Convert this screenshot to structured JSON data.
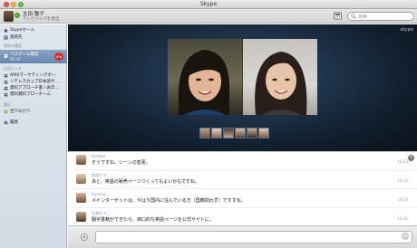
{
  "window": {
    "title": "Skype"
  },
  "profile": {
    "name": "太田 敬子",
    "mood": "テレビジャパを見出"
  },
  "search": {
    "placeholder": "検索"
  },
  "sidebar": {
    "items": [
      {
        "label": "Skypeホーム",
        "icon": "home-icon"
      },
      {
        "label": "連絡先",
        "icon": "contacts-icon"
      }
    ],
    "recent_heading": "現在の通話",
    "active_call": {
      "label": "リスチーム電話",
      "duration": "00:44"
    },
    "favorites_heading": "お気に入り",
    "favorites": [
      {
        "label": "AIRSマーケティングボー"
      },
      {
        "label": "リテレスカップ日本語サ..."
      },
      {
        "label": "資料アプローチ書 / 表示..."
      },
      {
        "label": "資料資料プローチーム"
      }
    ],
    "recent2_heading": "最近",
    "recent2": [
      {
        "label": "百下みかり"
      }
    ],
    "history": {
      "label": "履歴"
    }
  },
  "video": {
    "logo": "skype"
  },
  "chat": {
    "messages": [
      {
        "author": "Kumiko",
        "text": "そうですね。シーンの変更。",
        "time": "14:23"
      },
      {
        "author": "倉間すず",
        "text": "あと、英語の販売ページつくってもよいかもですね。",
        "time": "14:24"
      },
      {
        "author": "Kumiko",
        "text": "メインターゲットは、やはり国内に住んでいる方（国籍問わず）ですすね。",
        "time": "14:24"
      },
      {
        "author": "石塚もえこ",
        "text": "翻字書籍ができたら、両口的な英語ページを公式サイトに。",
        "time": "14:24"
      }
    ]
  },
  "colors": {
    "accent": "#6786b0",
    "hangup": "#d72c2c",
    "online": "#5bb83b"
  }
}
